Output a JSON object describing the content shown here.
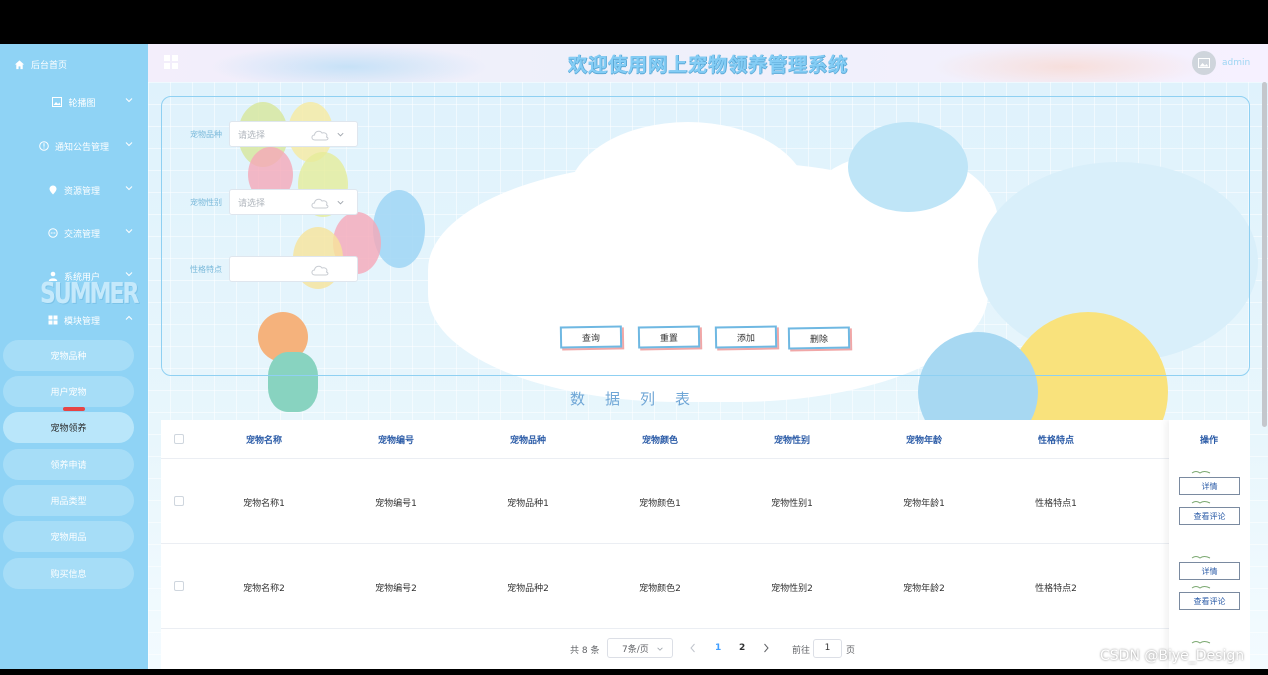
{
  "sidebar": {
    "home_label": "后台首页",
    "menus": [
      {
        "label": "轮播图",
        "icon": "image-icon"
      },
      {
        "label": "通知公告管理",
        "icon": "info-icon"
      },
      {
        "label": "资源管理",
        "icon": "location-icon"
      },
      {
        "label": "交流管理",
        "icon": "chat-icon"
      },
      {
        "label": "系统用户",
        "icon": "user-icon"
      },
      {
        "label": "模块管理",
        "icon": "grid-icon"
      }
    ],
    "submenu": [
      "宠物品种",
      "用户宠物",
      "宠物领养",
      "领养申请",
      "用品类型",
      "宠物用品",
      "购买信息"
    ],
    "active_sub": "宠物领养",
    "decor_text": "SUMMER"
  },
  "header": {
    "title": "欢迎使用网上宠物领养管理系统",
    "user": "admin"
  },
  "search": {
    "breed_label": "宠物品种",
    "breed_placeholder": "请选择",
    "gender_label": "宠物性别",
    "gender_placeholder": "请选择",
    "trait_label": "性格特点",
    "trait_value": "",
    "buttons": {
      "query": "查询",
      "reset": "重置",
      "add": "添加",
      "delete": "删除"
    }
  },
  "list_title": "数据列表",
  "table": {
    "headers": [
      "宠物名称",
      "宠物编号",
      "宠物品种",
      "宠物颜色",
      "宠物性别",
      "宠物年龄",
      "性格特点",
      "操作"
    ],
    "rows": [
      [
        "宠物名称1",
        "宠物编号1",
        "宠物品种1",
        "宠物颜色1",
        "宠物性别1",
        "宠物年龄1",
        "性格特点1"
      ],
      [
        "宠物名称2",
        "宠物编号2",
        "宠物品种2",
        "宠物颜色2",
        "宠物性别2",
        "宠物年龄2",
        "性格特点2"
      ]
    ],
    "row_actions": {
      "detail": "详情",
      "comments": "查看评论"
    }
  },
  "pagination": {
    "total": "共 8 条",
    "page_size": "7条/页",
    "pages": [
      "1",
      "2"
    ],
    "current_page": "1",
    "goto_label": "前往",
    "goto_value": "1",
    "page_unit": "页"
  },
  "watermark": "CSDN @Biye_Design",
  "colors": {
    "sidebar": "#8fd3f5",
    "accent": "#6fb8e2",
    "title": "#84cdf5",
    "header_text": "#2d5da8"
  }
}
